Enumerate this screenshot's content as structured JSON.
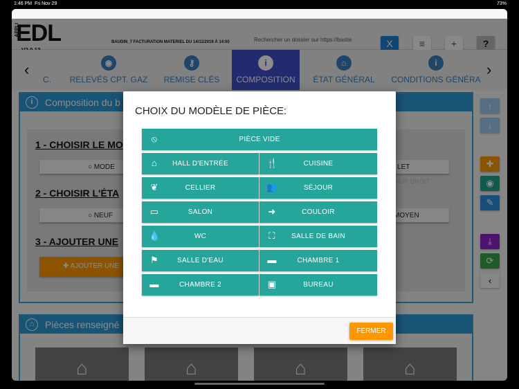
{
  "status_bar": {
    "time": "1:46 PM",
    "date": "Fri Nov 29",
    "battery": "73%"
  },
  "header": {
    "logo": "EDL",
    "logo_prefix": "APPLI",
    "version": "V2.0.13",
    "dossier": "BAUDIN_7 FACTURATION MATERIEL DU 14/11/2019 À 14:00",
    "search_placeholder": "Rechercher un dossier sur https://bastie",
    "clear_label": "X",
    "menu_label": "≡",
    "add_label": "+",
    "help_label": "?"
  },
  "tabs": [
    {
      "label": "C."
    },
    {
      "label": "RELEVÉS CPT. GAZ"
    },
    {
      "label": "REMISE CLÉS"
    },
    {
      "label": "COMPOSITION",
      "active": true
    },
    {
      "label": "ÉTAT GÉNÉRAL"
    },
    {
      "label": "CONDITIONS GÉNÉRA"
    }
  ],
  "composition": {
    "title": "Composition du b",
    "step1": "1 - CHOISIR LE MO",
    "step1_option": "MODE",
    "step1_option_right": "LET",
    "faint_text": "E, MUR DROIT",
    "step2": "2 - CHOISIR L'ÉTA",
    "step2_option": "NEUF",
    "step2_option_right": "MOYEN",
    "step3": "3 - AJOUTER UNE",
    "add_button": "AJOUTER UNE"
  },
  "pieces": {
    "title": "Pièces renseigné"
  },
  "modal": {
    "title": "CHOIX DU MODÈLE DE PIÈCE:",
    "full": {
      "label": "PIÈCE VIDE",
      "icon": "ban-icon"
    },
    "rows": [
      [
        {
          "label": "HALL D'ENTRÉE",
          "icon": "home-icon"
        },
        {
          "label": "CUISINE",
          "icon": "utensils-icon"
        }
      ],
      [
        {
          "label": "CELLIER",
          "icon": "leaf-icon"
        },
        {
          "label": "SÉJOUR",
          "icon": "users-icon"
        }
      ],
      [
        {
          "label": "SALON",
          "icon": "desktop-icon"
        },
        {
          "label": "COULOIR",
          "icon": "sign-in-icon"
        }
      ],
      [
        {
          "label": "WC",
          "icon": "tint-icon"
        },
        {
          "label": "SALLE DE BAIN",
          "icon": "bath-icon"
        }
      ],
      [
        {
          "label": "SALLE D'EAU",
          "icon": "shower-icon"
        },
        {
          "label": "CHAMBRE 1",
          "icon": "bed-icon"
        }
      ],
      [
        {
          "label": "CHAMBRE 2",
          "icon": "bed-icon"
        },
        {
          "label": "BUREAU",
          "icon": "briefcase-icon"
        }
      ]
    ],
    "close_label": "FERMER"
  },
  "colors": {
    "teal": "#26a69a",
    "orange": "#ff9800",
    "active_tab": "#3f4fc9",
    "panel_blue": "#2b9ad6"
  }
}
